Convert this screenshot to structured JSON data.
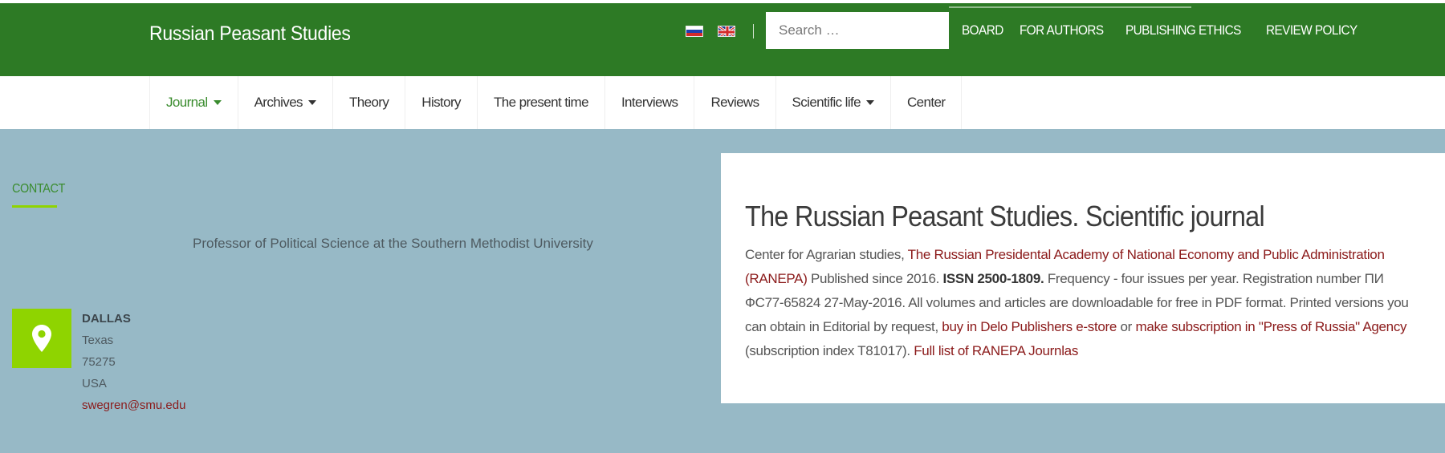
{
  "header": {
    "site_title": "Russian Peasant Studies",
    "search": {
      "placeholder": "Search …",
      "value": ""
    },
    "language_flags": [
      "flag-russia-icon",
      "flag-uk-icon"
    ],
    "top_links": [
      "BOARD",
      "FOR AUTHORS",
      "PUBLISHING ETHICS",
      "REVIEW POLICY"
    ],
    "colors": {
      "header_bg": "#2d7a25",
      "link_red": "#8b1a1a",
      "accent_green": "#8fd400"
    }
  },
  "nav": {
    "items": [
      {
        "label": "Journal",
        "dropdown": true,
        "active": true
      },
      {
        "label": "Archives",
        "dropdown": true,
        "active": false
      },
      {
        "label": "Theory",
        "dropdown": false,
        "active": false
      },
      {
        "label": "History",
        "dropdown": false,
        "active": false
      },
      {
        "label": "The present time",
        "dropdown": false,
        "active": false
      },
      {
        "label": "Interviews",
        "dropdown": false,
        "active": false
      },
      {
        "label": "Reviews",
        "dropdown": false,
        "active": false
      },
      {
        "label": "Scientific life",
        "dropdown": true,
        "active": false
      },
      {
        "label": "Center",
        "dropdown": false,
        "active": false
      }
    ]
  },
  "contact": {
    "heading": "CONTACT",
    "role": "Professor of Political Science at the Southern Methodist University",
    "icon": "map-pin-icon",
    "city": "DALLAS",
    "state": "Texas",
    "zip": "75275",
    "country": "USA",
    "email": "swegren@smu.edu"
  },
  "journal": {
    "title": "The Russian Peasant Studies. Scientific journal",
    "text_1": "Center for Agrarian studies, ",
    "link_ranepa": "The Russian Presidental Academy of National Economy and Public Administration (RANEPA)",
    "text_2": " Published since 2016. ",
    "issn": "ISSN 2500-1809.",
    "text_3": " Frequency - four issues per year. Registration number ПИ  ФС77-65824 27-May-2016. All volumes and articles are downloadable for free in PDF format.  Printed versions you can obtain in Editorial by request, ",
    "link_delo": "buy in Delo Publishers e-store",
    "text_4": " or ",
    "link_press": "make subscription in \"Press of Russia\" Agency",
    "text_5": " (subscription index  T81017). ",
    "link_list": "Full list of RANEPA Journlas"
  }
}
